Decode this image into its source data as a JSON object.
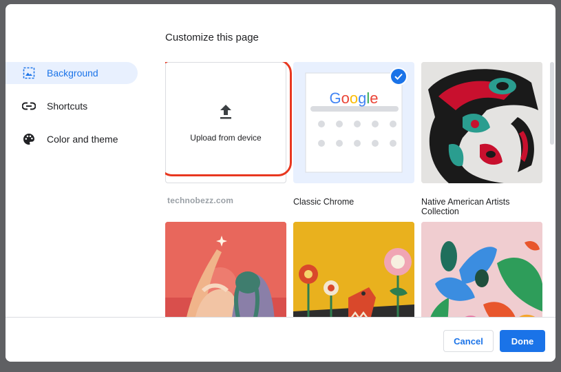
{
  "dialog": {
    "title": "Customize this page"
  },
  "sidebar": {
    "items": [
      {
        "label": "Background",
        "icon": "image-icon",
        "selected": true
      },
      {
        "label": "Shortcuts",
        "icon": "link-icon",
        "selected": false
      },
      {
        "label": "Color and theme",
        "icon": "palette-icon",
        "selected": false
      }
    ]
  },
  "tiles": {
    "upload": {
      "label": "Upload from device",
      "icon": "upload-icon"
    },
    "watermark": "technobezz.com",
    "classic": {
      "label": "Classic Chrome",
      "logo": "Google",
      "selected": true
    },
    "native": {
      "label": "Native American Artists Collection"
    }
  },
  "footer": {
    "cancel_label": "Cancel",
    "done_label": "Done"
  },
  "colors": {
    "accent": "#1a73e8",
    "highlight": "#e8371f"
  }
}
